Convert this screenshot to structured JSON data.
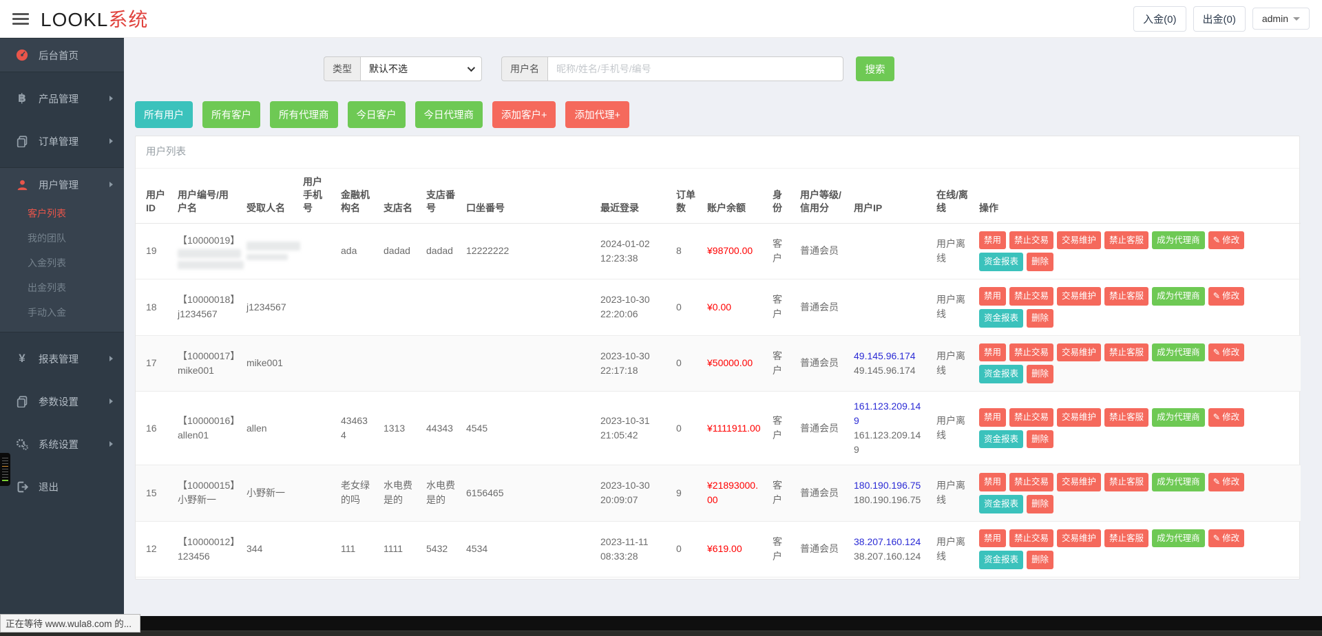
{
  "header": {
    "logo_black": "LOOKL",
    "logo_red": "系统",
    "deposit_label": "入金(0)",
    "withdraw_label": "出金(0)",
    "admin_label": "admin"
  },
  "sidebar": {
    "items": [
      {
        "label": "后台首页",
        "icon": "dashboard-icon",
        "group": true,
        "arrow": false,
        "children": []
      },
      {
        "label": "产品管理",
        "icon": "bitcoin-icon",
        "group": false,
        "arrow": true,
        "children": []
      },
      {
        "label": "订单管理",
        "icon": "orders-icon",
        "group": false,
        "arrow": true,
        "children": []
      },
      {
        "label": "用户管理",
        "icon": "user-icon",
        "group": true,
        "arrow": true,
        "children": [
          {
            "label": "客户列表",
            "active": true
          },
          {
            "label": "我的团队",
            "active": false
          },
          {
            "label": "入金列表",
            "active": false
          },
          {
            "label": "出金列表",
            "active": false
          },
          {
            "label": "手动入金",
            "active": false
          }
        ]
      },
      {
        "label": "报表管理",
        "icon": "yen-icon",
        "group": false,
        "arrow": true,
        "children": []
      },
      {
        "label": "参数设置",
        "icon": "params-icon",
        "group": false,
        "arrow": true,
        "children": []
      },
      {
        "label": "系统设置",
        "icon": "settings-icon",
        "group": false,
        "arrow": true,
        "children": []
      },
      {
        "label": "退出",
        "icon": "logout-icon",
        "group": false,
        "arrow": false,
        "children": []
      }
    ]
  },
  "filters": {
    "type_label": "类型",
    "type_value": "默认不选",
    "username_label": "用户名",
    "username_placeholder": "昵称/姓名/手机号/编号",
    "search_label": "搜索"
  },
  "quick_buttons": [
    {
      "label": "所有用户",
      "color": "teal"
    },
    {
      "label": "所有客户",
      "color": "green"
    },
    {
      "label": "所有代理商",
      "color": "green"
    },
    {
      "label": "今日客户",
      "color": "green"
    },
    {
      "label": "今日代理商",
      "color": "green"
    },
    {
      "label": "添加客户+",
      "color": "red"
    },
    {
      "label": "添加代理+",
      "color": "red"
    }
  ],
  "panel": {
    "title": "用户列表"
  },
  "table": {
    "columns": [
      "用户ID",
      "用户编号/用户名",
      "受取人名",
      "用户手机号",
      "金融机构名",
      "支店名",
      "支店番号",
      "口坐番号",
      "最近登录",
      "订单数",
      "账户余额",
      "身份",
      "用户等级/信用分",
      "用户IP",
      "在线/离线",
      "操作"
    ],
    "rows": [
      {
        "id": "19",
        "user_no": "【10000019】",
        "username": "",
        "username_censored": true,
        "receiver": "",
        "receiver_censored": true,
        "phone": "",
        "bank": "ada",
        "branch": "dadad",
        "branch_no": "dadad",
        "account_no": "12222222",
        "last_login": "2024-01-02 12:23:38",
        "orders": "8",
        "balance": "¥98700.00",
        "role": "客户",
        "level": "普通会员",
        "ip1": "",
        "ip2": "",
        "online": "用户离线"
      },
      {
        "id": "18",
        "user_no": "【10000018】",
        "username": "j1234567",
        "username_censored": false,
        "receiver": "j1234567",
        "receiver_censored": false,
        "phone": "",
        "bank": "",
        "branch": "",
        "branch_no": "",
        "account_no": "",
        "last_login": "2023-10-30 22:20:06",
        "orders": "0",
        "balance": "¥0.00",
        "role": "客户",
        "level": "普通会员",
        "ip1": "",
        "ip2": "",
        "online": "用户离线"
      },
      {
        "id": "17",
        "user_no": "【10000017】",
        "username": "mike001",
        "username_censored": false,
        "receiver": "mike001",
        "receiver_censored": false,
        "phone": "",
        "bank": "",
        "branch": "",
        "branch_no": "",
        "account_no": "",
        "last_login": "2023-10-30 22:17:18",
        "orders": "0",
        "balance": "¥50000.00",
        "role": "客户",
        "level": "普通会员",
        "ip1": "49.145.96.174",
        "ip2": "49.145.96.174",
        "online": "用户离线"
      },
      {
        "id": "16",
        "user_no": "【10000016】",
        "username": "allen01",
        "username_censored": false,
        "receiver": "allen",
        "receiver_censored": false,
        "phone": "",
        "bank": "434634",
        "branch": "1313",
        "branch_no": "44343",
        "account_no": "4545",
        "last_login": "2023-10-31 21:05:42",
        "orders": "0",
        "balance": "¥1111911.00",
        "role": "客户",
        "level": "普通会员",
        "ip1": "161.123.209.149",
        "ip2": "161.123.209.149",
        "online": "用户离线"
      },
      {
        "id": "15",
        "user_no": "【10000015】",
        "username": "小野新一",
        "username_censored": false,
        "receiver": "小野新一",
        "receiver_censored": false,
        "phone": "",
        "bank": "老女绿的吗",
        "branch": "水电费是的",
        "branch_no": "水电费是的",
        "account_no": "6156465",
        "last_login": "2023-10-30 20:09:07",
        "orders": "9",
        "balance": "¥21893000.00",
        "role": "客户",
        "level": "普通会员",
        "ip1": "180.190.196.75",
        "ip2": "180.190.196.75",
        "online": "用户离线"
      },
      {
        "id": "12",
        "user_no": "【10000012】",
        "username": "123456",
        "username_censored": false,
        "receiver": "344",
        "receiver_censored": false,
        "phone": "",
        "bank": "111",
        "branch": "1111",
        "branch_no": "5432",
        "account_no": "4534",
        "last_login": "2023-11-11 08:33:28",
        "orders": "0",
        "balance": "¥619.00",
        "role": "客户",
        "level": "普通会员",
        "ip1": "38.207.160.124",
        "ip2": "38.207.160.124",
        "online": "用户离线"
      }
    ],
    "row_actions_line1": [
      {
        "label": "禁用",
        "color": "red",
        "icon": ""
      },
      {
        "label": "禁止交易",
        "color": "red",
        "icon": ""
      },
      {
        "label": "交易维护",
        "color": "red",
        "icon": ""
      },
      {
        "label": "禁止客服",
        "color": "red",
        "icon": ""
      },
      {
        "label": "成为代理商",
        "color": "green",
        "icon": ""
      },
      {
        "label": "修改",
        "color": "red",
        "icon": "pencil"
      }
    ],
    "row_actions_line2": [
      {
        "label": "资金报表",
        "color": "teal",
        "icon": ""
      },
      {
        "label": "删除",
        "color": "red",
        "icon": ""
      }
    ]
  },
  "statusbar": {
    "text": "正在等待 www.wula8.com 的..."
  },
  "colors": {
    "green": "#6ec954",
    "teal": "#3bc2bc",
    "red": "#f5695c",
    "amount_red": "#ff0000",
    "ip_link_blue": "#2b2bd5",
    "sidebar_bg": "#2f3a45",
    "active_menu_red": "#e8554a",
    "logo_red": "#e0433e"
  }
}
